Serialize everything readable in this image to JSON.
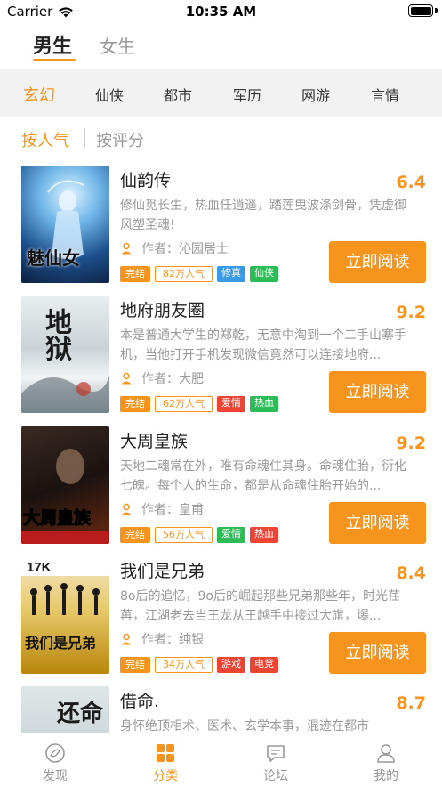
{
  "status_bar": {
    "carrier": "Carrier",
    "time": "10:35 AM"
  },
  "gender_tabs": [
    {
      "label": "男生",
      "active": true
    },
    {
      "label": "女生",
      "active": false
    }
  ],
  "categories": [
    {
      "label": "玄幻",
      "active": true
    },
    {
      "label": "仙侠",
      "active": false
    },
    {
      "label": "都市",
      "active": false
    },
    {
      "label": "军历",
      "active": false
    },
    {
      "label": "网游",
      "active": false
    },
    {
      "label": "言情",
      "active": false
    }
  ],
  "sort_tabs": [
    {
      "label": "按人气",
      "active": true
    },
    {
      "label": "按评分",
      "active": false
    }
  ],
  "books": [
    {
      "title": "仙韵传",
      "score": "6.4",
      "description": "修仙觅长生，热血任逍遥，踏莲曳波涤剑骨，凭虚御风塑圣魂!",
      "author": "作者：沁园居士",
      "status": "完结",
      "popularity": "82万人气",
      "tags": [
        {
          "label": "修真",
          "color": "#3a9ae8"
        },
        {
          "label": "仙侠",
          "color": "#2dbb57"
        }
      ],
      "button": "立即阅读",
      "cover_text": "魅仙女"
    },
    {
      "title": "地府朋友圈",
      "score": "9.2",
      "description": "本是普通大学生的郑乾，无意中淘到一个二手山寨手机，当他打开手机发现微信竟然可以连接地府...",
      "author": "作者：大肥",
      "status": "完结",
      "popularity": "62万人气",
      "tags": [
        {
          "label": "爱情",
          "color": "#ee4433"
        },
        {
          "label": "热血",
          "color": "#2dbb57"
        }
      ],
      "button": "立即阅读",
      "cover_text": "地狱"
    },
    {
      "title": "大周皇族",
      "score": "9.2",
      "description": "天地二魂常在外，唯有命魂住其身。命魂住胎，衍化七魄。每个人的生命，都是从命魂住胎开始的...",
      "author": "作者：皇甫",
      "status": "完结",
      "popularity": "56万人气",
      "tags": [
        {
          "label": "爱情",
          "color": "#2dbb57"
        },
        {
          "label": "热血",
          "color": "#ee4433"
        }
      ],
      "button": "立即阅读",
      "cover_text": "大周皇族"
    },
    {
      "title": "我们是兄弟",
      "score": "8.4",
      "description": "8o后的追忆，9o后的崛起那些兄弟那些年，时光荏苒，江湖老去当王龙从王越手中接过大旗，爆...",
      "author": "作者：纯银",
      "status": "完结",
      "popularity": "34万人气",
      "tags": [
        {
          "label": "游戏",
          "color": "#ee4433"
        },
        {
          "label": "电竞",
          "color": "#ee4433"
        }
      ],
      "button": "立即阅读",
      "cover_text": "我们是兄弟"
    },
    {
      "title": "借命.",
      "score": "8.7",
      "description": "身怀绝顶相术、医术、玄学本事，混迹在都市",
      "cover_text": "还命"
    }
  ],
  "tab_bar": [
    {
      "label": "发现",
      "icon": "compass-icon",
      "active": false
    },
    {
      "label": "分类",
      "icon": "grid-icon",
      "active": true
    },
    {
      "label": "论坛",
      "icon": "chat-bubble-icon",
      "active": false
    },
    {
      "label": "我的",
      "icon": "person-icon",
      "active": false
    }
  ],
  "colors": {
    "accent": "#f7941d",
    "category_bg": "#f2f2f2",
    "muted": "#999999"
  }
}
